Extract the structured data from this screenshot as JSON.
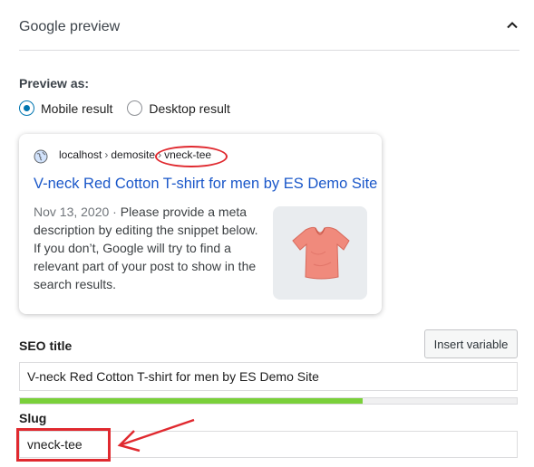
{
  "section": {
    "title": "Google preview"
  },
  "preview": {
    "label": "Preview as:",
    "options": [
      {
        "label": "Mobile result",
        "checked": true
      },
      {
        "label": "Desktop result",
        "checked": false
      }
    ]
  },
  "snippet_card": {
    "breadcrumb": {
      "host": "localhost",
      "sep": "›",
      "site": "demosite",
      "slug": "vneck-tee"
    },
    "title": "V-neck Red Cotton T-shirt for men by ES Demo Site",
    "date": "Nov 13, 2020",
    "date_sep": " · ",
    "description": "Please provide a meta description by editing the snippet below. If you don’t, Google will try to find a relevant part of your post to show in the search results."
  },
  "seo_title": {
    "label": "SEO title",
    "insert_variable_label": "Insert variable",
    "value": "V-neck Red Cotton T-shirt for men by ES Demo Site",
    "progress_fraction": 0.69
  },
  "slug": {
    "label": "Slug",
    "value": "vneck-tee"
  },
  "colors": {
    "link": "#1a57c9",
    "accent": "#0075b0",
    "progress": "#7ad03a",
    "annotation": "#e0292f"
  },
  "icons": [
    "chevron-up-icon",
    "globe-icon",
    "tshirt-image",
    "annotation-arrow"
  ]
}
